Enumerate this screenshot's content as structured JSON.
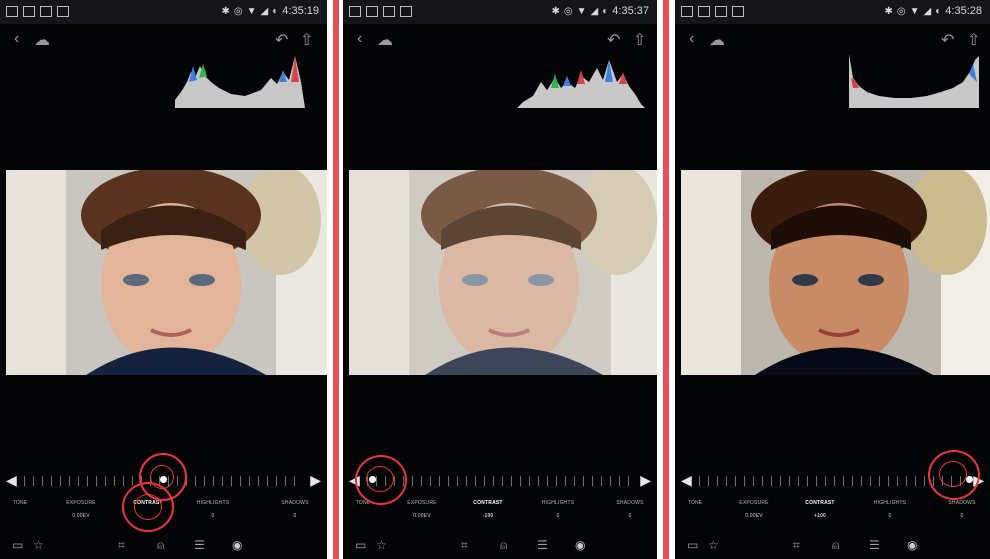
{
  "screens": [
    {
      "time": "4:35:19",
      "adjust": [
        {
          "label": "TONE",
          "value": ""
        },
        {
          "label": "EXPOSURE",
          "value": "0.00EV"
        },
        {
          "label": "CONTRAST",
          "value": ""
        },
        {
          "label": "HIGHLIGHTS",
          "value": "0"
        },
        {
          "label": "SHADOWS",
          "value": "0"
        }
      ],
      "slider_position": 0.5
    },
    {
      "time": "4:35:37",
      "adjust": [
        {
          "label": "TONE",
          "value": ""
        },
        {
          "label": "EXPOSURE",
          "value": "0.00EV"
        },
        {
          "label": "CONTRAST",
          "value": "-100"
        },
        {
          "label": "HIGHLIGHTS",
          "value": "0"
        },
        {
          "label": "SHADOWS",
          "value": "0"
        }
      ],
      "slider_position": 0.0
    },
    {
      "time": "4:35:28",
      "adjust": [
        {
          "label": "TONE",
          "value": ""
        },
        {
          "label": "EXPOSURE",
          "value": "0.00EV"
        },
        {
          "label": "CONTRAST",
          "value": "+100"
        },
        {
          "label": "HIGHLIGHTS",
          "value": "0"
        },
        {
          "label": "SHADOWS",
          "value": "0"
        }
      ],
      "slider_position": 1.0
    }
  ],
  "icons": {
    "back": "back-arrow-icon",
    "cloud": "cloud-sync-icon",
    "undo": "undo-icon",
    "share": "share-icon",
    "toolbar": [
      "comment-icon",
      "rating-icon",
      "crop-icon",
      "presets-icon",
      "adjust-icon",
      "selective-icon"
    ]
  },
  "colors": {
    "accent_ring": "#ec3340",
    "banner": "#ea4e55",
    "panel_bg": "#030406"
  }
}
